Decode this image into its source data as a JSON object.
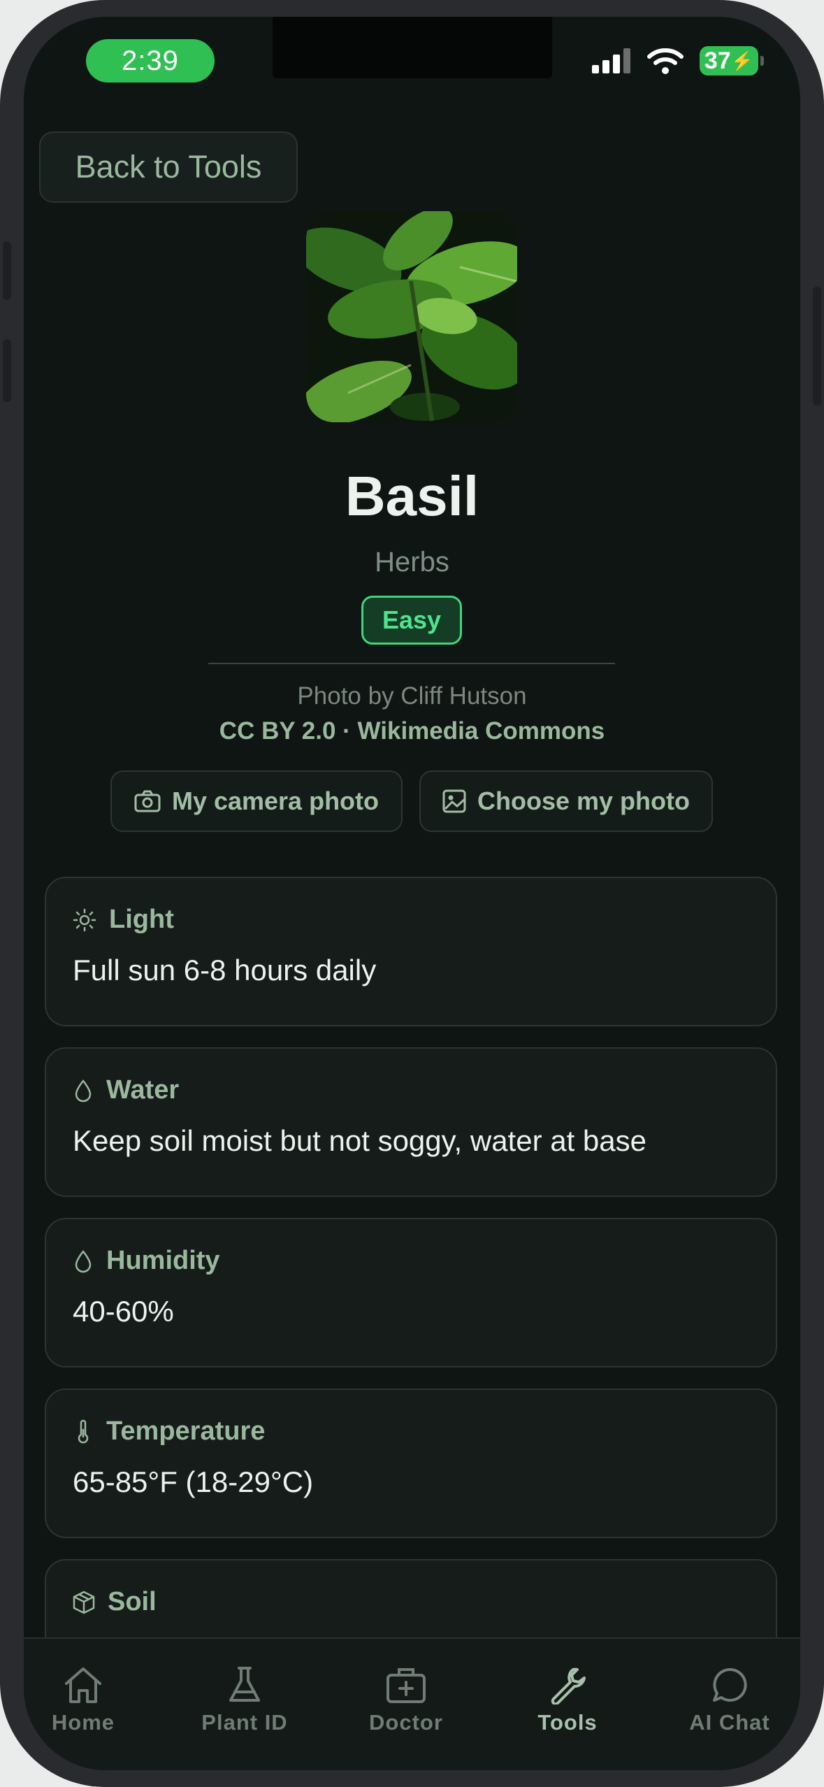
{
  "status_bar": {
    "time": "2:39",
    "battery": "37"
  },
  "back_button": {
    "label": "Back to Tools"
  },
  "plant": {
    "name": "Basil",
    "category": "Herbs",
    "difficulty": "Easy",
    "photo_credit": "Photo by Cliff Hutson",
    "license": "CC BY 2.0 · Wikimedia Commons"
  },
  "photo_actions": {
    "camera_label": "My camera photo",
    "choose_label": "Choose my photo"
  },
  "care": {
    "light": {
      "label": "Light",
      "value": "Full sun 6-8 hours daily"
    },
    "water": {
      "label": "Water",
      "value": "Keep soil moist but not soggy, water at base"
    },
    "humidity": {
      "label": "Humidity",
      "value": "40-60%"
    },
    "temperature": {
      "label": "Temperature",
      "value": "65-85°F (18-29°C)"
    },
    "soil": {
      "label": "Soil",
      "value": ""
    }
  },
  "tabs": [
    {
      "label": "Home",
      "icon": "home-icon"
    },
    {
      "label": "Plant ID",
      "icon": "flask-icon"
    },
    {
      "label": "Doctor",
      "icon": "medical-kit-icon"
    },
    {
      "label": "Tools",
      "icon": "wrench-icon",
      "active": true
    },
    {
      "label": "AI Chat",
      "icon": "chat-bubble-icon"
    }
  ],
  "colors": {
    "background": "#0f1513",
    "accent_green": "#3fd57a",
    "muted_green": "#9bb89f",
    "status_green": "#2fbf53"
  }
}
